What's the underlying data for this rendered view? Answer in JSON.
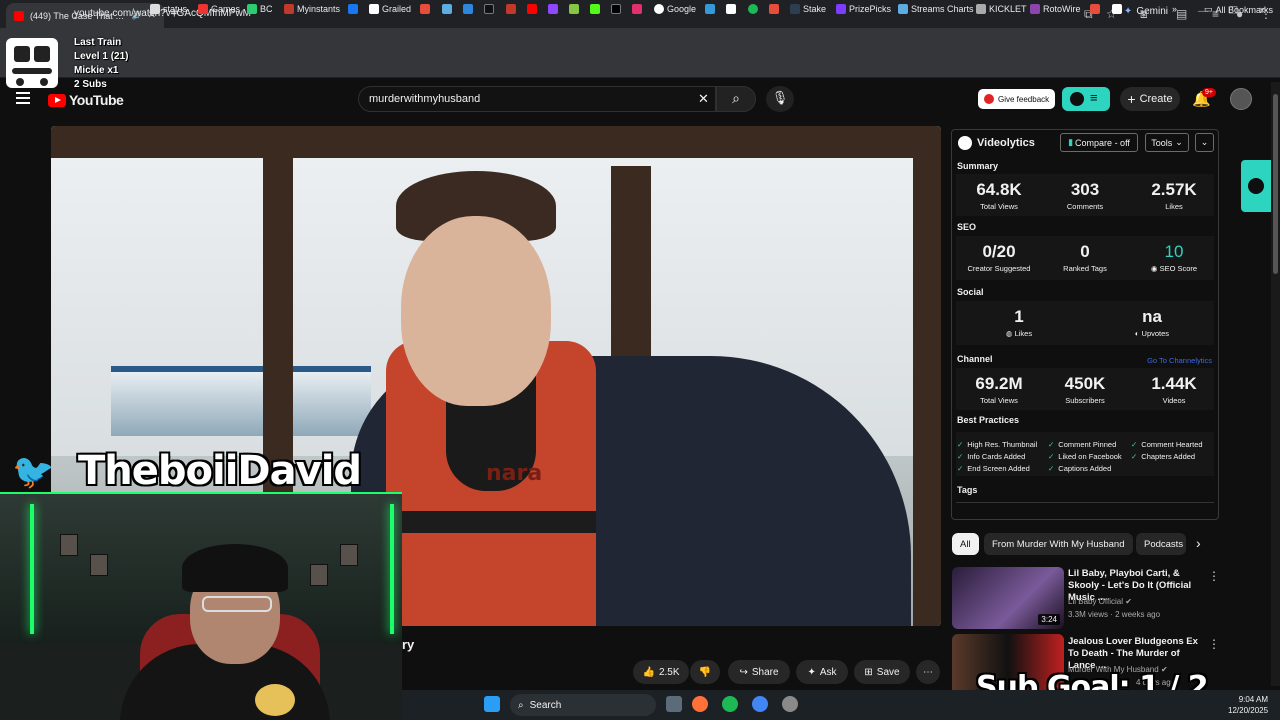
{
  "browser": {
    "tab_title": "(449) The Case That Proved",
    "url": "youtube.com/watch?v=GAcQMfnMPwM",
    "gemini_label": "Gemini",
    "all_bookmarks": "All Bookmarks",
    "bookmarks": [
      "status",
      "Games",
      "BC",
      "Myinstants",
      "Grailed",
      "Google",
      "Stake",
      "PrizePicks",
      "Streams Charts",
      "KICKLET",
      "RotoWire"
    ]
  },
  "overlay": {
    "train_title": "Last Train",
    "train_level": "Level 1  (21)",
    "train_user": "Mickie x1",
    "train_subs": "2 Subs",
    "handle": "TheboiiDavid",
    "sub_goal": "Sub Goal:  1 / 2"
  },
  "youtube": {
    "logo_text": "YouTube",
    "search_value": "murderwithmyhusband",
    "feedback_label": "Give feedback",
    "create_label": "Create",
    "notif_badge": "9+",
    "video_logo_text": "nara",
    "title_fragment": "ry",
    "actions": {
      "likes": "2.5K",
      "share": "Share",
      "ask": "Ask",
      "save": "Save"
    }
  },
  "videolytics": {
    "title": "Videolytics",
    "compare": "Compare - off",
    "tools": "Tools",
    "summary_label": "Summary",
    "summary": [
      {
        "num": "64.8K",
        "label": "Total Views"
      },
      {
        "num": "303",
        "label": "Comments"
      },
      {
        "num": "2.57K",
        "label": "Likes"
      }
    ],
    "seo_label": "SEO",
    "seo": [
      {
        "num": "0/20",
        "label": "Creator Suggested"
      },
      {
        "num": "0",
        "label": "Ranked Tags"
      },
      {
        "num": "10",
        "label": "SEO Score"
      }
    ],
    "social_label": "Social",
    "social": [
      {
        "num": "1",
        "label": "Likes"
      },
      {
        "num": "na",
        "label": "Upvotes"
      }
    ],
    "channel_label": "Channel",
    "channel_link": "Go To Channelytics",
    "channel": [
      {
        "num": "69.2M",
        "label": "Total Views"
      },
      {
        "num": "450K",
        "label": "Subscribers"
      },
      {
        "num": "1.44K",
        "label": "Videos"
      }
    ],
    "best_practices_label": "Best Practices",
    "best_practices": [
      "High Res. Thumbnail",
      "Comment Pinned",
      "Comment Hearted",
      "Info Cards Added",
      "Liked on Facebook",
      "Chapters Added",
      "End Screen Added",
      "Captions Added"
    ],
    "tags_label": "Tags",
    "colors": {
      "accent": "#2dd4bf",
      "link": "#3e6ae1"
    }
  },
  "chips": [
    "All",
    "From Murder With My Husband",
    "Podcasts"
  ],
  "recommendations": [
    {
      "title": "Lil Baby, Playboi Carti, & Skooly - Let's Do It (Official Music ...",
      "channel": "Lil Baby Official",
      "meta": "3.3M views · 2 weeks ago",
      "duration": "3:24"
    },
    {
      "title": "Jealous Lover Bludgeons Ex To Death - The Murder of Lance ...",
      "channel": "Murder With My Husband",
      "meta": "4 days ago",
      "duration": ""
    }
  ],
  "taskbar": {
    "search_label": "Search",
    "time": "9:04 AM",
    "date": "12/20/2025"
  }
}
